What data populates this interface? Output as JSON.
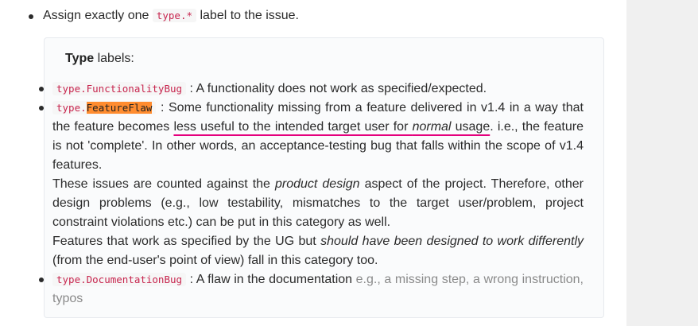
{
  "outer": {
    "prefix": "Assign exactly one",
    "code": "type.*",
    "suffix": "label to the issue."
  },
  "box": {
    "title_bold": "Type",
    "title_rest": " labels:"
  },
  "items": [
    {
      "code": "type.FunctionalityBug",
      "text": ": A functionality does not work as specified/expected."
    },
    {
      "code_prefix": "type.",
      "code_highlight": "FeatureFlaw",
      "line1": ": Some functionality missing from a feature delivered in v1.4 in a way that the feature becomes ",
      "underline_a": "less useful to the intended target user for ",
      "underline_em": "normal",
      "underline_b": " usage",
      "line1_end": ". i.e., the feature is not 'complete'. In other words, an acceptance-testing bug that falls within the scope of v1.4 features.",
      "para2_a": "These issues are counted against the ",
      "para2_em": "product design",
      "para2_b": " aspect of the project. Therefore, other design problems (e.g., low testability, mismatches to the target user/problem, project constraint violations etc.) can be put in this category as well.",
      "para3_a": "Features that work as specified by the UG but ",
      "para3_em": "should have been designed to work differently",
      "para3_b": " (from the end-user's point of view) fall in this category too."
    },
    {
      "code": "type.DocumentationBug",
      "text": ": A flaw in the documentation ",
      "muted": "e.g., a missing step, a wrong instruction, typos"
    }
  ],
  "colors": {
    "code_text": "#c7254e",
    "highlight": "#ff8c2f",
    "underline": "#e5007d"
  }
}
